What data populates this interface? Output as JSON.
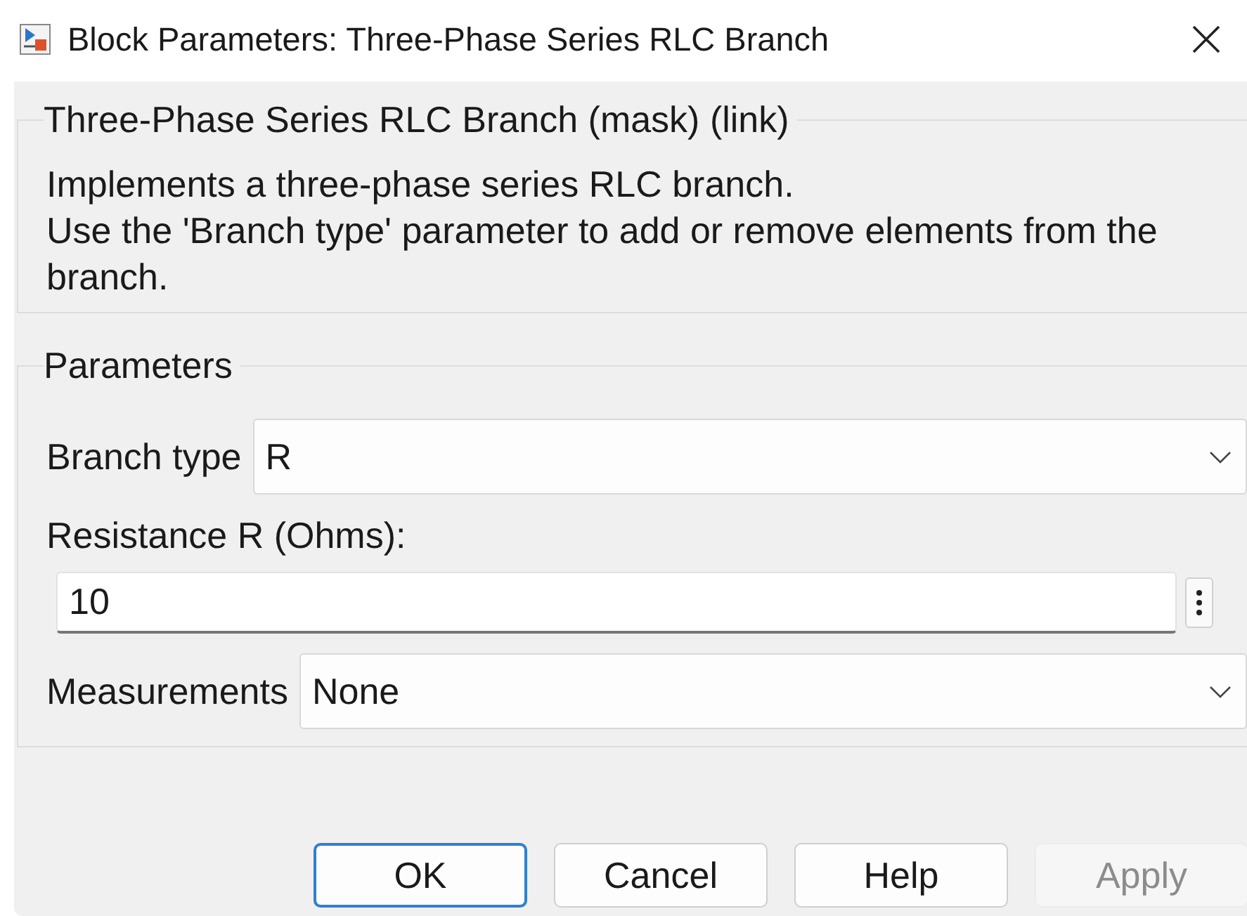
{
  "window": {
    "title": "Block Parameters: Three-Phase Series RLC Branch"
  },
  "description": {
    "title": "Three-Phase Series RLC Branch (mask) (link)",
    "lines": [
      "Implements a three-phase series RLC branch.",
      "Use the 'Branch type' parameter to add or remove elements from the branch."
    ]
  },
  "parameters": {
    "title": "Parameters",
    "items": [
      {
        "kind": "combo",
        "label": "Branch type",
        "value": "R"
      },
      {
        "kind": "edit",
        "label": "Resistance R (Ohms):",
        "value": "10"
      },
      {
        "kind": "combo",
        "label": "Measurements",
        "value": "None"
      }
    ]
  },
  "buttons": [
    {
      "label": "OK",
      "default": true,
      "disabled": false
    },
    {
      "label": "Cancel",
      "default": false,
      "disabled": false
    },
    {
      "label": "Help",
      "default": false,
      "disabled": false
    },
    {
      "label": "Apply",
      "default": false,
      "disabled": true
    }
  ]
}
